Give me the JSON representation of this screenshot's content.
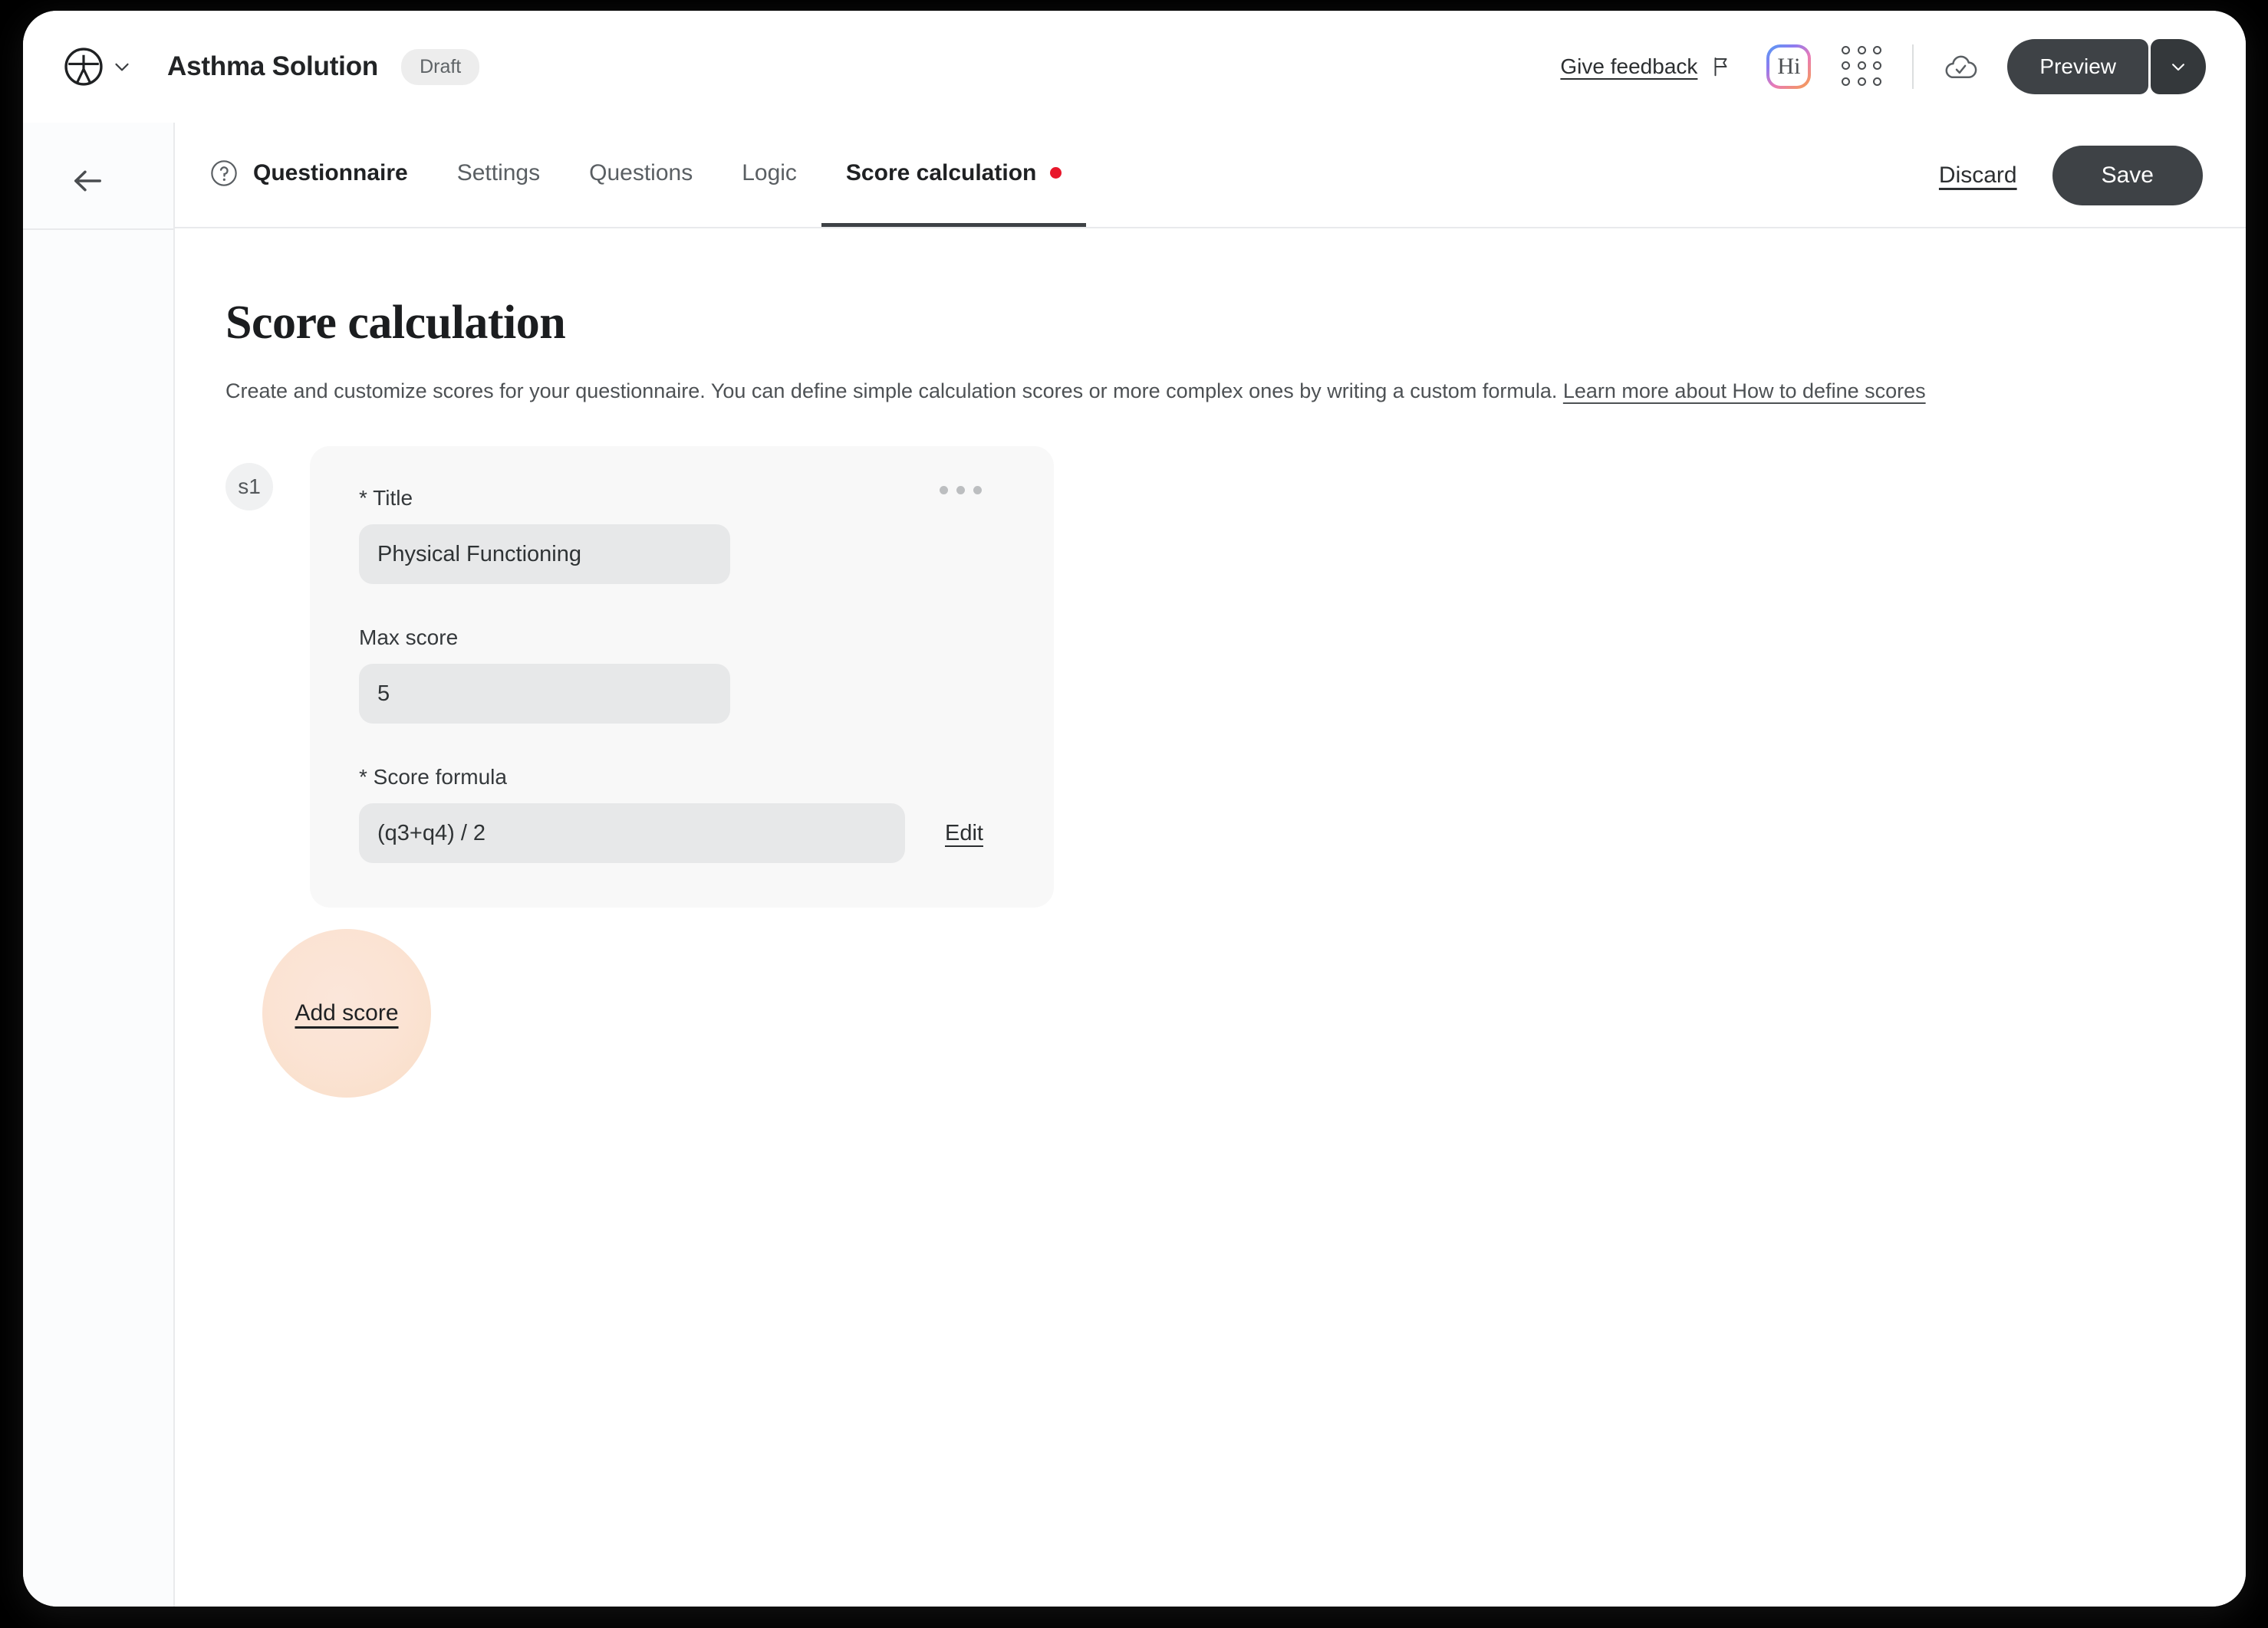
{
  "topbar": {
    "logo_icon": "vitruvian-circle-logo",
    "logo_caret_icon": "chevron-down-icon",
    "app_title": "Asthma Solution",
    "status_badge": "Draft",
    "give_feedback": "Give feedback",
    "flag_icon": "flag-icon",
    "avatar_label": "Hi",
    "apps_icon": "apps-grid-icon",
    "cloud_icon": "cloud-check-icon",
    "preview_label": "Preview",
    "preview_caret_icon": "chevron-down-icon"
  },
  "rail": {
    "back_icon": "arrow-left-icon"
  },
  "tabbar": {
    "questionnaire_icon": "question-circle-icon",
    "tabs": [
      {
        "label": "Questionnaire",
        "active": false,
        "has_icon": true,
        "dot": false
      },
      {
        "label": "Settings",
        "active": false,
        "has_icon": false,
        "dot": false
      },
      {
        "label": "Questions",
        "active": false,
        "has_icon": false,
        "dot": false
      },
      {
        "label": "Logic",
        "active": false,
        "has_icon": false,
        "dot": false
      },
      {
        "label": "Score calculation",
        "active": true,
        "has_icon": false,
        "dot": true
      }
    ],
    "discard_label": "Discard",
    "save_label": "Save",
    "unsaved_dot_color": "#e8172b"
  },
  "main": {
    "title": "Score calculation",
    "description_prefix": "Create and customize scores for your questionnaire. You can define simple calculation scores or more complex ones by writing a custom formula. ",
    "learn_more_link": "Learn more about How to define scores",
    "score": {
      "badge": "s1",
      "menu_icon": "more-horizontal-icon",
      "title_label": "* Title",
      "title_value": "Physical Functioning",
      "max_score_label": "Max score",
      "max_score_value": "5",
      "formula_label": "* Score formula",
      "formula_value": "(q3+q4) / 2",
      "edit_label": "Edit"
    },
    "add_score_label": "Add score",
    "click_highlight_color": "#fae3d5"
  },
  "colors": {
    "dark_button": "#3e4246",
    "card_bg": "#f8f8f8",
    "input_bg": "#e7e8e9",
    "page_bg": "#ffffff",
    "outer_bg": "#000000"
  }
}
